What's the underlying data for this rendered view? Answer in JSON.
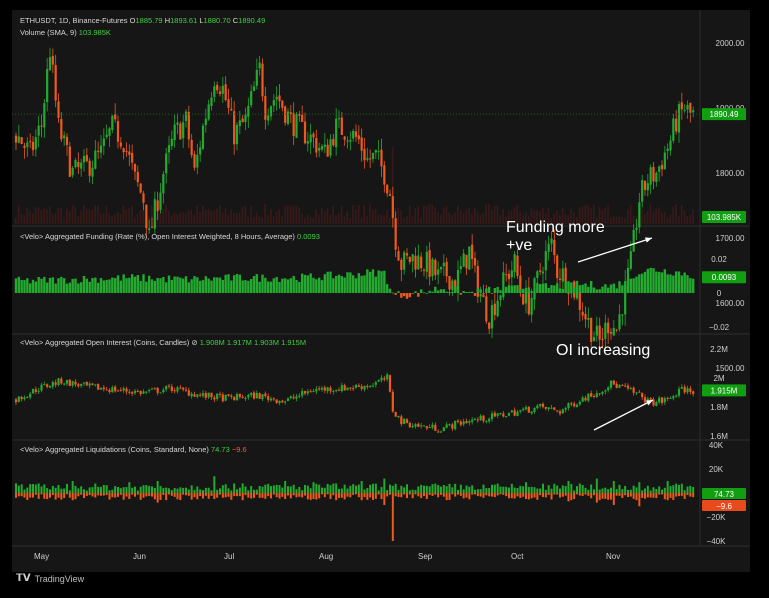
{
  "header": {
    "symbol": "ETHUSDT, 1D, Binance-Futures",
    "o_label": "O",
    "o": "1885.79",
    "h_label": "H",
    "h": "1893.61",
    "l_label": "L",
    "l": "1880.70",
    "c_label": "C",
    "c": "1890.49",
    "volume_label": "Volume (SMA, 9)",
    "volume_value": "103.985K"
  },
  "funding_header": {
    "label": "<Velo> Aggregated Funding (Rate (%), Open Interest Weighted, 8 Hours, Average)",
    "value": "0.0093"
  },
  "oi_header": {
    "label": "<Velo> Aggregated Open Interest (Coins, Candles)",
    "circle": "⊘",
    "values": "1.908M 1.917M 1.903M 1.915M"
  },
  "liq_header": {
    "label": "<Velo> Aggregated Liquidations (Coins, Standard, None)",
    "pos": "74.73",
    "neg": "−9.6"
  },
  "annotations": {
    "funding": [
      "Funding more",
      "+ve"
    ],
    "oi": "OI increasing"
  },
  "brand": "TradingView",
  "colors": {
    "up": "#22ab2f",
    "down": "#ee5a1c",
    "bg": "#161616",
    "label_green": "#119e11",
    "label_red": "#e84a1b"
  },
  "chart_data": [
    {
      "type": "candlestick",
      "title": "ETHUSDT, 1D, Binance-Futures",
      "x_ticks": [
        "May",
        "Jun",
        "Jul",
        "Aug",
        "Sep",
        "Oct",
        "Nov"
      ],
      "y_ticks": [
        "2000.00",
        "1900.00",
        "1800.00",
        "1700.00",
        "1600.00",
        "1500.00"
      ],
      "ylim": [
        1450,
        2050
      ],
      "last_price": "1890.49",
      "close_path": [
        [
          0,
          1860
        ],
        [
          5,
          1830
        ],
        [
          9,
          1875
        ],
        [
          12,
          1990
        ],
        [
          15,
          1870
        ],
        [
          20,
          1800
        ],
        [
          25,
          1810
        ],
        [
          30,
          1830
        ],
        [
          34,
          1870
        ],
        [
          38,
          1850
        ],
        [
          42,
          1790
        ],
        [
          45,
          1760
        ],
        [
          47,
          1700
        ],
        [
          52,
          1800
        ],
        [
          56,
          1860
        ],
        [
          60,
          1880
        ],
        [
          63,
          1800
        ],
        [
          66,
          1870
        ],
        [
          70,
          1950
        ],
        [
          73,
          1930
        ],
        [
          77,
          1860
        ],
        [
          81,
          1880
        ],
        [
          86,
          1960
        ],
        [
          88,
          1900
        ],
        [
          92,
          1920
        ],
        [
          97,
          1880
        ],
        [
          101,
          1865
        ],
        [
          105,
          1850
        ],
        [
          109,
          1830
        ],
        [
          113,
          1870
        ],
        [
          117,
          1865
        ],
        [
          121,
          1850
        ],
        [
          124,
          1820
        ],
        [
          127,
          1825
        ],
        [
          130,
          1800
        ],
        [
          132,
          1770
        ],
        [
          134,
          1700
        ],
        [
          136,
          1660
        ],
        [
          140,
          1670
        ],
        [
          145,
          1660
        ],
        [
          149,
          1640
        ],
        [
          152,
          1645
        ],
        [
          155,
          1630
        ],
        [
          157,
          1650
        ],
        [
          160,
          1680
        ],
        [
          162,
          1640
        ],
        [
          165,
          1600
        ],
        [
          167,
          1580
        ],
        [
          170,
          1610
        ],
        [
          173,
          1640
        ],
        [
          176,
          1660
        ],
        [
          178,
          1620
        ],
        [
          181,
          1600
        ],
        [
          183,
          1620
        ],
        [
          186,
          1665
        ],
        [
          189,
          1690
        ],
        [
          191,
          1650
        ],
        [
          194,
          1640
        ],
        [
          197,
          1620
        ],
        [
          200,
          1590
        ],
        [
          203,
          1560
        ],
        [
          206,
          1540
        ],
        [
          209,
          1570
        ],
        [
          212,
          1560
        ],
        [
          214,
          1600
        ],
        [
          217,
          1660
        ],
        [
          220,
          1760
        ],
        [
          223,
          1790
        ],
        [
          226,
          1800
        ],
        [
          229,
          1830
        ],
        [
          231,
          1850
        ],
        [
          233,
          1880
        ],
        [
          236,
          1900
        ],
        [
          238,
          1890
        ]
      ],
      "volume_sma_value": "103.985K"
    },
    {
      "type": "bar",
      "title": "Aggregated Funding",
      "y_ticks": [
        "0.02",
        "0.0093",
        "0",
        "−0.02"
      ],
      "ylim": [
        -0.025,
        0.025
      ],
      "current": "0.0093",
      "level_path": [
        [
          0,
          0.006
        ],
        [
          20,
          0.007
        ],
        [
          40,
          0.008
        ],
        [
          60,
          0.007
        ],
        [
          80,
          0.008
        ],
        [
          100,
          0.008
        ],
        [
          110,
          0.009
        ],
        [
          120,
          0.01
        ],
        [
          125,
          0.011
        ],
        [
          130,
          0.011
        ],
        [
          133,
          -0.002
        ],
        [
          140,
          -0.002
        ],
        [
          150,
          0.002
        ],
        [
          160,
          -0.001
        ],
        [
          170,
          0.001
        ],
        [
          180,
          0.002
        ],
        [
          190,
          0.003
        ],
        [
          200,
          0.004
        ],
        [
          210,
          0.003
        ],
        [
          216,
          0.006
        ],
        [
          219,
          0.011
        ],
        [
          225,
          0.013
        ],
        [
          230,
          0.012
        ],
        [
          235,
          0.011
        ],
        [
          238,
          0.0093
        ]
      ]
    },
    {
      "type": "candlestick",
      "title": "Aggregated Open Interest",
      "y_ticks": [
        "2.2M",
        "2M",
        "1.915M",
        "1.8M",
        "1.6M"
      ],
      "ylim": [
        1.55,
        2.25
      ],
      "current": "1.915M",
      "close_path": [
        [
          0,
          1.85
        ],
        [
          8,
          1.93
        ],
        [
          16,
          1.98
        ],
        [
          25,
          1.94
        ],
        [
          35,
          1.92
        ],
        [
          45,
          1.9
        ],
        [
          55,
          1.93
        ],
        [
          65,
          1.88
        ],
        [
          75,
          1.86
        ],
        [
          85,
          1.88
        ],
        [
          95,
          1.84
        ],
        [
          105,
          1.92
        ],
        [
          115,
          1.93
        ],
        [
          125,
          1.95
        ],
        [
          131,
          2.0
        ],
        [
          133,
          1.78
        ],
        [
          136,
          1.7
        ],
        [
          142,
          1.67
        ],
        [
          150,
          1.65
        ],
        [
          158,
          1.7
        ],
        [
          165,
          1.72
        ],
        [
          175,
          1.76
        ],
        [
          185,
          1.8
        ],
        [
          192,
          1.77
        ],
        [
          200,
          1.86
        ],
        [
          205,
          1.9
        ],
        [
          210,
          1.96
        ],
        [
          215,
          1.93
        ],
        [
          220,
          1.88
        ],
        [
          224,
          1.83
        ],
        [
          230,
          1.85
        ],
        [
          235,
          1.92
        ],
        [
          238,
          1.915
        ]
      ]
    },
    {
      "type": "bar",
      "title": "Aggregated Liquidations",
      "y_ticks": [
        "40K",
        "20K",
        "74.73",
        "−9.6",
        "−20K",
        "−40K"
      ],
      "ylim": [
        -42,
        42
      ],
      "pos_value": "74.73",
      "neg_value": "−9.6",
      "spikes": [
        [
          0,
          8,
          -4
        ],
        [
          20,
          10,
          -6
        ],
        [
          40,
          9,
          -5
        ],
        [
          50,
          10,
          -8
        ],
        [
          70,
          14,
          -5
        ],
        [
          80,
          8,
          -6
        ],
        [
          95,
          10,
          -5
        ],
        [
          105,
          9,
          -5
        ],
        [
          113,
          8,
          -6
        ],
        [
          122,
          10,
          -6
        ],
        [
          130,
          12,
          -10
        ],
        [
          133,
          6,
          -40
        ],
        [
          145,
          6,
          -5
        ],
        [
          165,
          7,
          -4
        ],
        [
          180,
          9,
          -5
        ],
        [
          195,
          10,
          -7
        ],
        [
          205,
          12,
          -8
        ],
        [
          211,
          10,
          -10
        ],
        [
          220,
          9,
          -11
        ],
        [
          230,
          10,
          -6
        ],
        [
          238,
          6,
          -3
        ]
      ]
    }
  ]
}
